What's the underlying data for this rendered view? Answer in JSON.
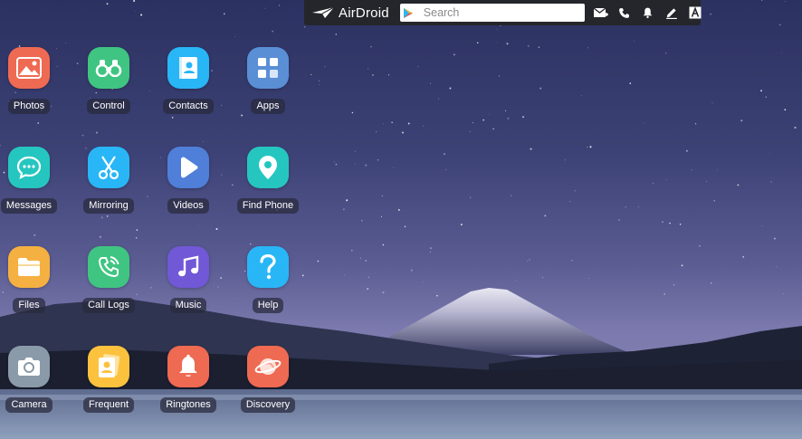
{
  "topbar": {
    "brand": "AirDroid",
    "search_placeholder": "Search",
    "icons": [
      "mail-icon",
      "phone-icon",
      "bell-icon",
      "pen-icon",
      "font-a-icon"
    ]
  },
  "apps": [
    {
      "label": "Photos",
      "icon": "photos-icon",
      "color": "#ef6a52"
    },
    {
      "label": "Control",
      "icon": "binoculars-icon",
      "color": "#3fc581"
    },
    {
      "label": "Contacts",
      "icon": "contacts-icon",
      "color": "#29b6f6"
    },
    {
      "label": "Apps",
      "icon": "apps-grid-icon",
      "color": "#5a8fd6"
    },
    {
      "label": "Messages",
      "icon": "chat-bubble-icon",
      "color": "#26c6c0"
    },
    {
      "label": "Mirroring",
      "icon": "scissors-icon",
      "color": "#29b6f6"
    },
    {
      "label": "Videos",
      "icon": "play-icon",
      "color": "#4f7fd8"
    },
    {
      "label": "Find Phone",
      "icon": "location-pin-icon",
      "color": "#26c6c0"
    },
    {
      "label": "Files",
      "icon": "folder-icon",
      "color": "#f5b042"
    },
    {
      "label": "Call Logs",
      "icon": "phone-call-icon",
      "color": "#3fc581"
    },
    {
      "label": "Music",
      "icon": "music-note-icon",
      "color": "#7058d6"
    },
    {
      "label": "Help",
      "icon": "question-icon",
      "color": "#29b6f6"
    },
    {
      "label": "Camera",
      "icon": "camera-icon",
      "color": "#8a9aa8"
    },
    {
      "label": "Frequent",
      "icon": "frequent-contact-icon",
      "color": "#fcc23e"
    },
    {
      "label": "Ringtones",
      "icon": "bell-ringtone-icon",
      "color": "#ef6a52"
    },
    {
      "label": "Discovery",
      "icon": "planet-icon",
      "color": "#ef6a52"
    }
  ]
}
